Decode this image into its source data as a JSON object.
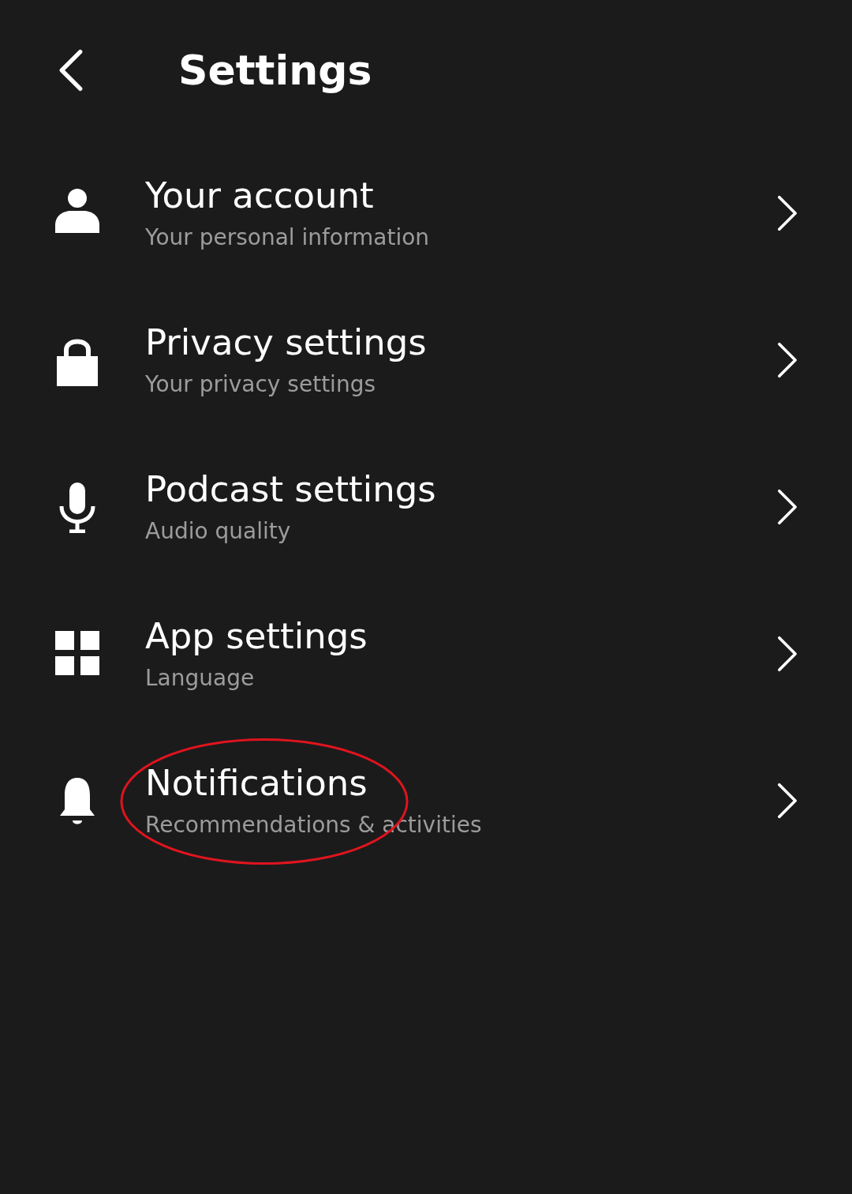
{
  "header": {
    "title": "Settings"
  },
  "items": [
    {
      "kind": "account",
      "title": "Your account",
      "subtitle": "Your personal information",
      "circled": false
    },
    {
      "kind": "privacy",
      "title": "Privacy settings",
      "subtitle": "Your privacy settings",
      "circled": false
    },
    {
      "kind": "podcast",
      "title": "Podcast settings",
      "subtitle": "Audio quality",
      "circled": false
    },
    {
      "kind": "app",
      "title": "App settings",
      "subtitle": "Language",
      "circled": false
    },
    {
      "kind": "notifications",
      "title": "Notifications",
      "subtitle": "Recommendations & activities",
      "circled": true
    }
  ]
}
